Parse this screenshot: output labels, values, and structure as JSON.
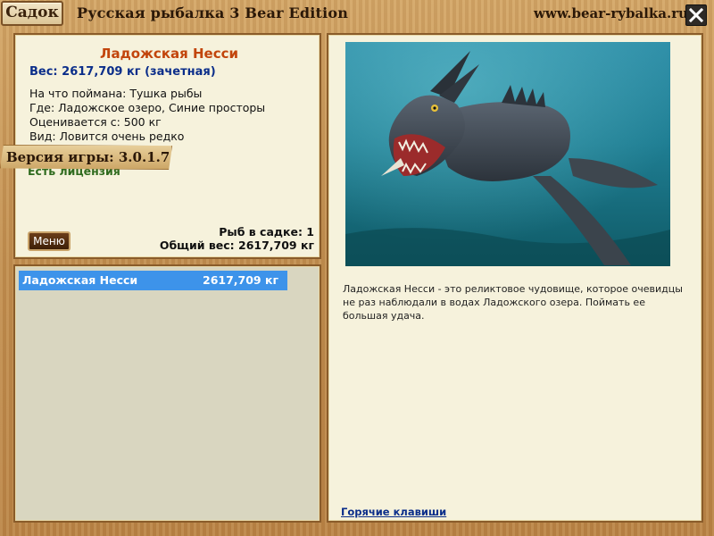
{
  "window": {
    "sadok_label": "Садок",
    "title": "Русская рыбалка 3 Bear Edition",
    "site": "www.bear-rybalka.ru",
    "close_icon": "close-icon"
  },
  "fish": {
    "name": "Ладожская Несси",
    "weight_text": "Вес: 2617,709 кг (зачетная)",
    "caught_on": "На что поймана: Тушка рыбы",
    "location": "Где: Ладожское озеро, Синие просторы",
    "valued_from": "Оценивается с: 500 кг",
    "rarity": "Вид: Ловится очень редко",
    "description": "Ладожская Несси - это реликтовое чудовище, которое очевидцы не раз наблюдали в водах Ладожского озера. Поймать ее большая удача."
  },
  "status": {
    "license": "Есть лицензия",
    "version": "Версия игры: 3.0.1.7",
    "fish_count": "Рыб в садке: 1",
    "total_weight": "Общий вес: 2617,709 кг"
  },
  "buttons": {
    "menu_label": "Меню",
    "hotkeys_label": "Горячие клавиши"
  },
  "list": {
    "items": [
      {
        "name": "Ладожская Несси",
        "weight": "2617,709 кг",
        "selected": true
      }
    ]
  },
  "colors": {
    "fish_name": "#c2450c",
    "weight": "#0b2e8a",
    "license": "#2f6b1e",
    "selection": "#3d93ea",
    "frame": "#c79a5b"
  }
}
